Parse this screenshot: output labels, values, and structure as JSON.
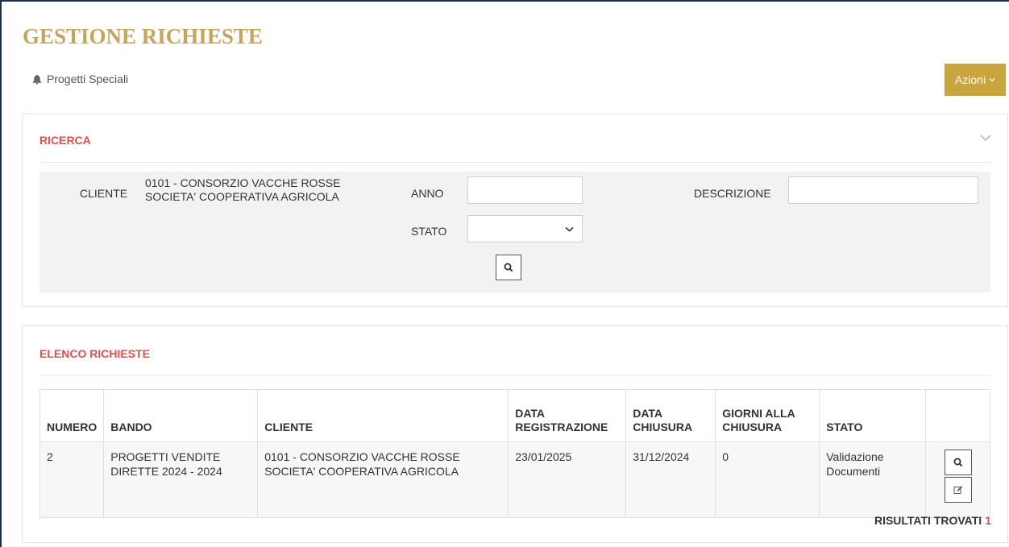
{
  "page": {
    "title": "GESTIONE RICHIESTE",
    "breadcrumb": "Progetti Speciali",
    "actions_label": "Azioni"
  },
  "search": {
    "title": "RICERCA",
    "cliente_label": "CLIENTE",
    "cliente_value": "0101 - CONSORZIO VACCHE ROSSE SOCIETA' COOPERATIVA AGRICOLA",
    "anno_label": "ANNO",
    "anno_value": "",
    "descrizione_label": "DESCRIZIONE",
    "descrizione_value": "",
    "stato_label": "STATO",
    "stato_value": ""
  },
  "list": {
    "title": "ELENCO RICHIESTE",
    "columns": {
      "numero": "NUMERO",
      "bando": "BANDO",
      "cliente": "CLIENTE",
      "data_registrazione": "DATA REGISTRAZIONE",
      "data_chiusura": "DATA CHIUSURA",
      "giorni": "GIORNI ALLA CHIUSURA",
      "stato": "STATO"
    },
    "rows": [
      {
        "numero": "2",
        "bando": "PROGETTI VENDITE DIRETTE 2024 - 2024",
        "cliente": "0101 - CONSORZIO VACCHE ROSSE SOCIETA' COOPERATIVA AGRICOLA",
        "data_registrazione": "23/01/2025",
        "data_chiusura": "31/12/2024",
        "giorni": "0",
        "stato": "Validazione Documenti"
      }
    ],
    "results_label": "RISULTATI TROVATI",
    "results_count": "1"
  },
  "colors": {
    "title_gold": "#c4a55a",
    "button_gold": "#c9a53d",
    "section_red": "#d9534f",
    "frame_navy": "#1f2d4d"
  },
  "icons": [
    "bell-icon",
    "chevron-down-icon",
    "search-icon",
    "edit-icon"
  ]
}
